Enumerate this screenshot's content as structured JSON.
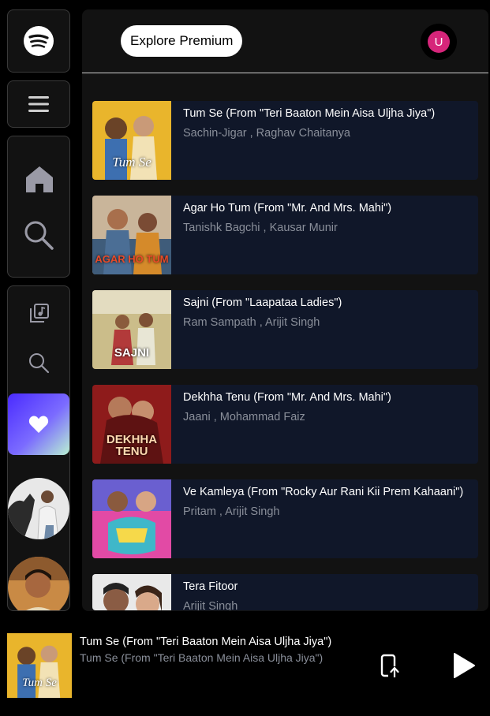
{
  "header": {
    "premium_label": "Explore Premium",
    "user_initial": "U"
  },
  "songs": [
    {
      "title": "Tum Se (From \"Teri Baaton Mein Aisa Uljha Jiya\")",
      "artists": "Sachin-Jigar , Raghav Chaitanya",
      "cover_text": "Tum Se"
    },
    {
      "title": "Agar Ho Tum (From \"Mr. And Mrs. Mahi\")",
      "artists": "Tanishk Bagchi , Kausar Munir",
      "cover_text": "AGAR HO TUM"
    },
    {
      "title": "Sajni (From \"Laapataa Ladies\")",
      "artists": "Ram Sampath , Arijit Singh",
      "cover_text": "SAJNI"
    },
    {
      "title": "Dekhha Tenu (From \"Mr. And Mrs. Mahi\")",
      "artists": "Jaani , Mohammad Faiz",
      "cover_text": "DEKHHA TENU"
    },
    {
      "title": "Ve Kamleya (From \"Rocky Aur Rani Kii Prem Kahaani\")",
      "artists": "Pritam , Arijit Singh",
      "cover_text": ""
    },
    {
      "title": "Tera Fitoor",
      "artists": "Arijit Singh",
      "cover_text": ""
    }
  ],
  "player": {
    "title": "Tum Se (From \"Teri Baaton Mein Aisa Uljha Jiya\")",
    "subtitle": "Tum Se (From \"Teri Baaton Mein Aisa Uljha Jiya\")",
    "cover_text": "Tum Se"
  },
  "colors": {
    "card_bg": "#101729",
    "accent_pink": "#d6257a",
    "liked_gradient_start": "#4a2bff"
  }
}
